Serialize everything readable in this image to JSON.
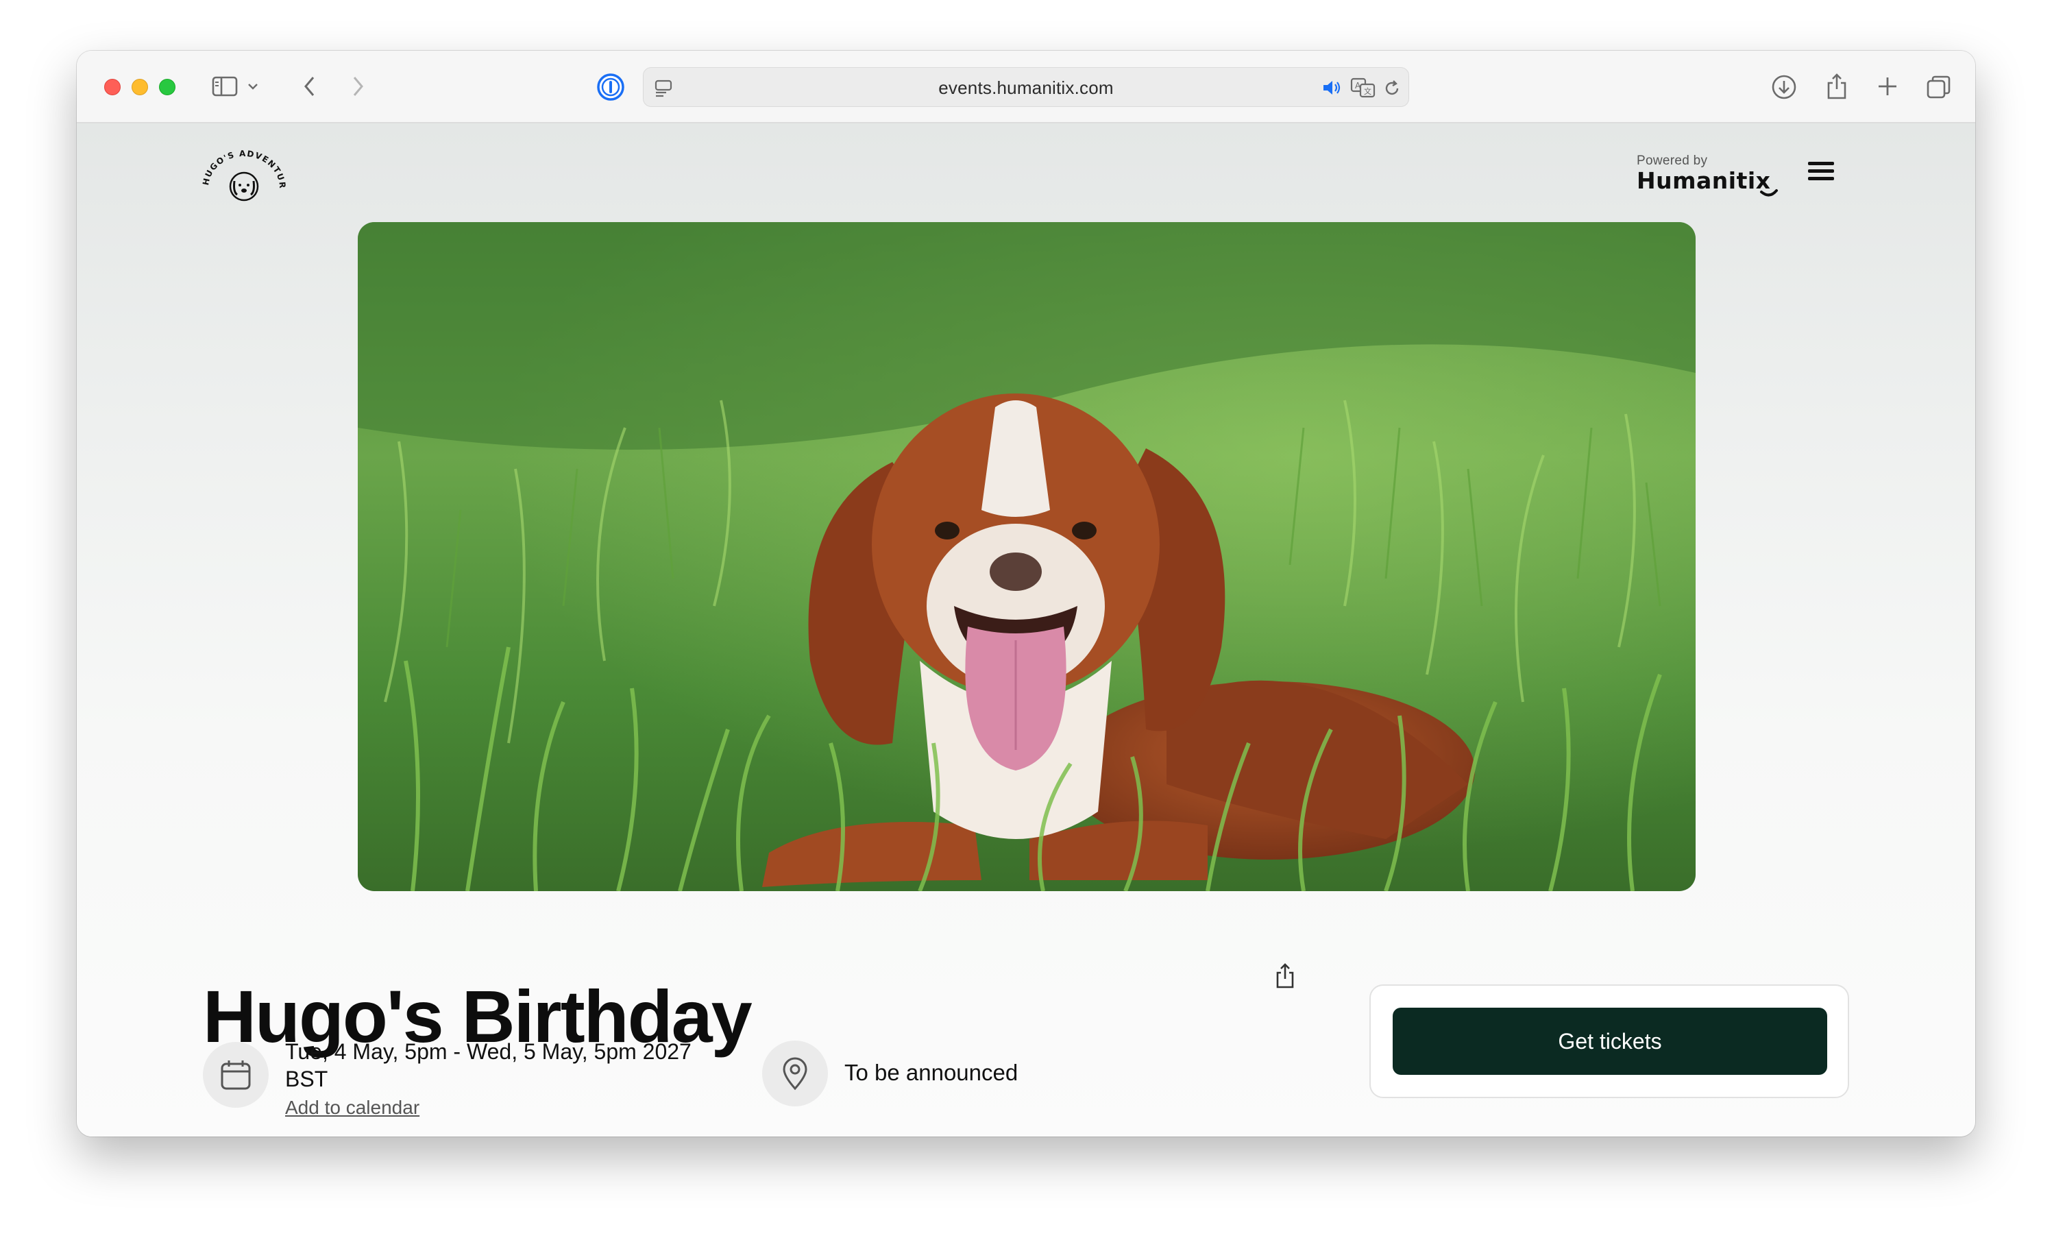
{
  "browser": {
    "url": "events.humanitix.com"
  },
  "header": {
    "logo_text": "HUGO'S ADVENTURES",
    "powered_by_label": "Powered by",
    "platform_name": "Humanitix"
  },
  "event": {
    "title": "Hugo's Birthday",
    "date_line1": "Tue, 4 May, 5pm - Wed, 5 May, 5pm 2027",
    "date_line2": "BST",
    "add_to_calendar_label": "Add to calendar",
    "location": "To be announced",
    "get_tickets_label": "Get tickets"
  },
  "colors": {
    "primary_button": "#0b2a22"
  }
}
